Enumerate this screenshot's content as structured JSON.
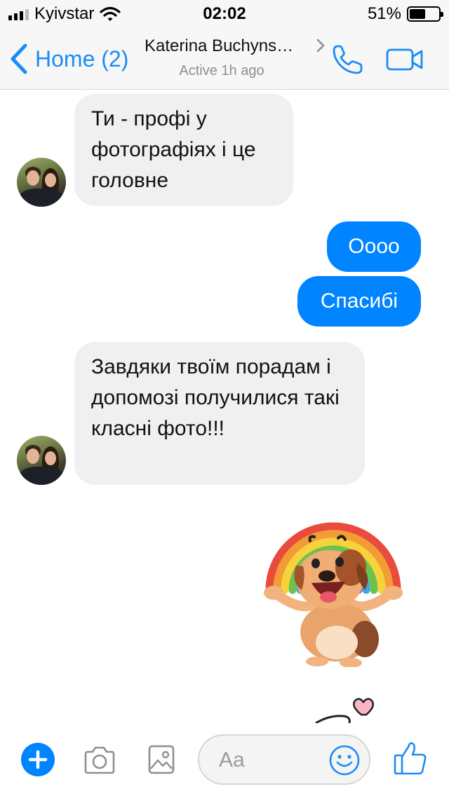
{
  "status_bar": {
    "carrier": "Kyivstar",
    "time": "02:02",
    "battery": "51%"
  },
  "header": {
    "back_label": "Home (2)",
    "contact_name": "Katerina Buchyns…",
    "active_status": "Active 1h ago"
  },
  "messages": [
    {
      "direction": "incoming",
      "text": "Ти - профі у фотографіях і це головне"
    },
    {
      "direction": "outgoing",
      "text": "Оооо"
    },
    {
      "direction": "outgoing",
      "text": "Спасибі"
    },
    {
      "direction": "incoming",
      "text": "Завдяки твоїм порадам і допомозі получилися такі класні фото!!!"
    },
    {
      "direction": "outgoing",
      "type": "sticker",
      "sticker": "dog-rainbow-sticker"
    }
  ],
  "composer": {
    "placeholder": "Aa"
  },
  "icons": {
    "back": "chevron-left-icon",
    "call": "phone-icon",
    "video": "video-camera-icon",
    "add": "plus-icon",
    "camera": "camera-icon",
    "gallery": "image-icon",
    "emoji": "smiley-icon",
    "like": "thumbs-up-icon"
  },
  "colors": {
    "accent": "#0084ff",
    "incoming_bubble": "#f1f0f0",
    "link": "#1a8cf5"
  }
}
